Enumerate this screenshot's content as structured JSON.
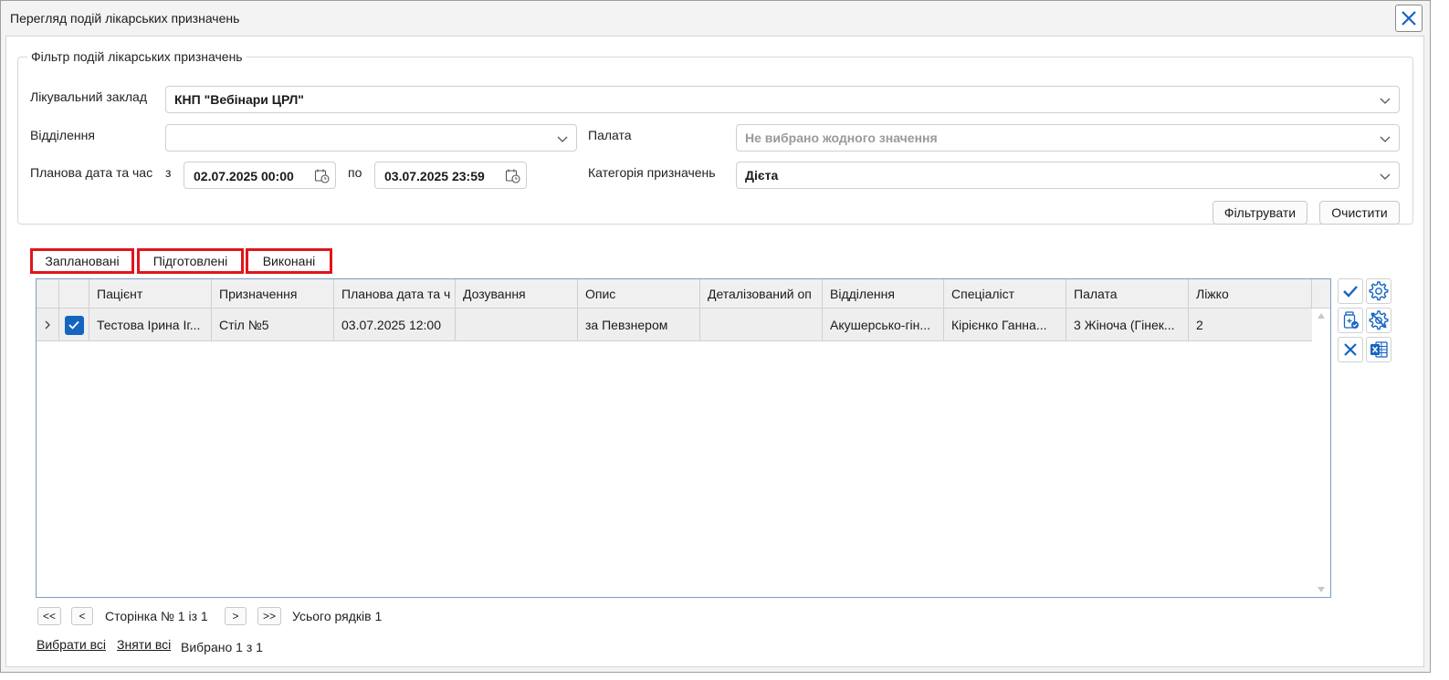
{
  "window": {
    "title": "Перегляд подій лікарських призначень"
  },
  "filter": {
    "legend": "Фільтр подій лікарських призначень",
    "facility_label": "Лікувальний заклад",
    "facility_value": "КНП \"Вебінари ЦРЛ\"",
    "department_label": "Відділення",
    "department_value": "",
    "ward_label": "Палата",
    "ward_placeholder": "Не вибрано жодного значення",
    "date_label": "Планова дата та час",
    "date_from_label": "з",
    "date_from": "02.07.2025 00:00",
    "date_to_label": "по",
    "date_to": "03.07.2025 23:59",
    "category_label": "Категорія призначень",
    "category_value": "Дієта",
    "filter_button": "Фільтрувати",
    "clear_button": "Очистити"
  },
  "tabs": [
    {
      "label": "Заплановані"
    },
    {
      "label": "Підготовлені"
    },
    {
      "label": "Виконані"
    }
  ],
  "grid": {
    "columns": [
      "Пацієнт",
      "Призначення",
      "Планова дата та ч",
      "Дозування",
      "Опис",
      "Деталізований оп",
      "Відділення",
      "Спеціаліст",
      "Палата",
      "Ліжко"
    ],
    "rows": [
      {
        "checked": true,
        "cells": [
          "Тестова Ірина Іг...",
          "Стіл №5",
          "03.07.2025 12:00",
          "",
          "за Певзнером",
          "",
          "Акушерсько-гін...",
          "Кірієнко Ганна...",
          "3 Жіноча (Гінек...",
          "2"
        ]
      }
    ]
  },
  "pager": {
    "first": "<<",
    "prev": "<",
    "page_text": "Сторінка № 1 із 1",
    "next": ">",
    "last": ">>",
    "total_text": "Усього рядків 1"
  },
  "selection": {
    "select_all": "Вибрати всі",
    "deselect_all": "Зняти всі",
    "selected_text": "Вибрано 1 з 1"
  },
  "colors": {
    "accent": "#1565c0",
    "tab_highlight": "#e0151b"
  }
}
